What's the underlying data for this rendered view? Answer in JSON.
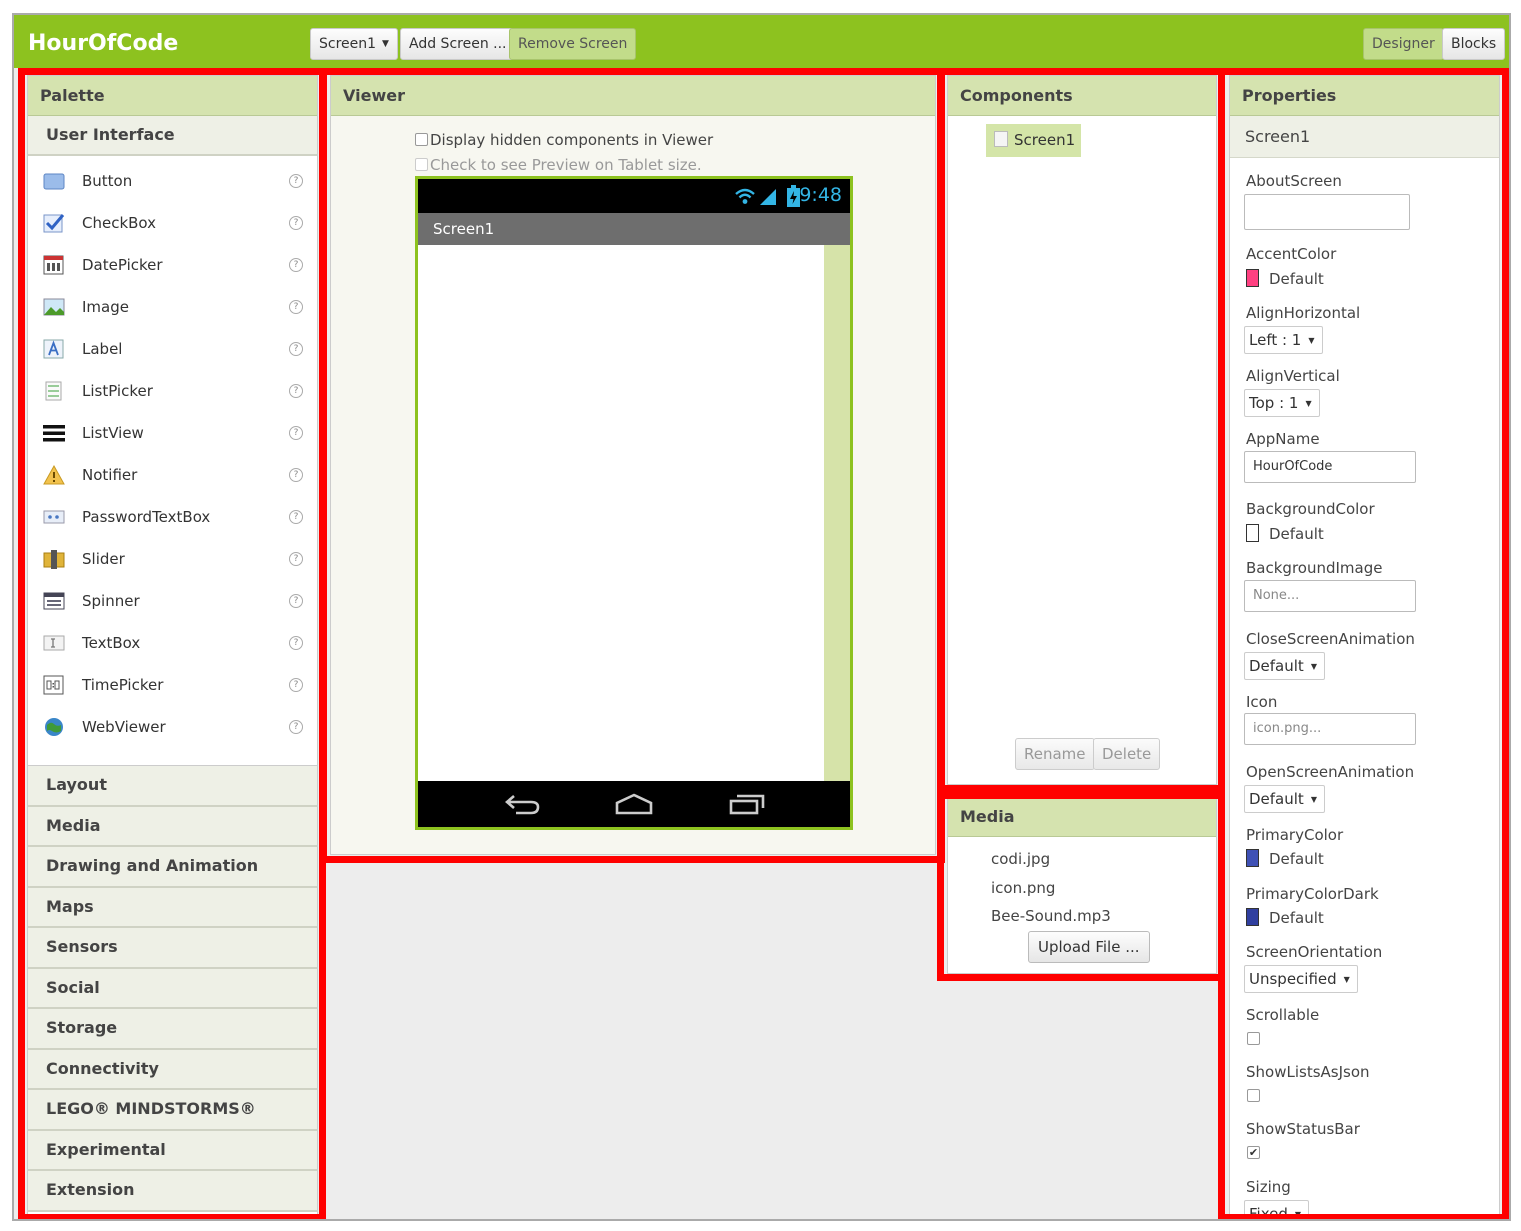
{
  "app": {
    "title": "HourOfCode"
  },
  "toolbar": {
    "screen_select": "Screen1",
    "add_screen": "Add Screen ...",
    "remove_screen": "Remove Screen",
    "designer": "Designer",
    "blocks": "Blocks"
  },
  "palette": {
    "title": "Palette",
    "open_category": "User Interface",
    "items": [
      {
        "label": "Button",
        "icon": "button-icon"
      },
      {
        "label": "CheckBox",
        "icon": "checkbox-icon"
      },
      {
        "label": "DatePicker",
        "icon": "datepicker-icon"
      },
      {
        "label": "Image",
        "icon": "image-icon"
      },
      {
        "label": "Label",
        "icon": "label-icon"
      },
      {
        "label": "ListPicker",
        "icon": "listpicker-icon"
      },
      {
        "label": "ListView",
        "icon": "listview-icon"
      },
      {
        "label": "Notifier",
        "icon": "notifier-icon"
      },
      {
        "label": "PasswordTextBox",
        "icon": "password-icon"
      },
      {
        "label": "Slider",
        "icon": "slider-icon"
      },
      {
        "label": "Spinner",
        "icon": "spinner-icon"
      },
      {
        "label": "TextBox",
        "icon": "textbox-icon"
      },
      {
        "label": "TimePicker",
        "icon": "timepicker-icon"
      },
      {
        "label": "WebViewer",
        "icon": "webviewer-icon"
      }
    ],
    "help_glyph": "?",
    "categories": [
      "Layout",
      "Media",
      "Drawing and Animation",
      "Maps",
      "Sensors",
      "Social",
      "Storage",
      "Connectivity",
      "LEGO® MINDSTORMS®",
      "Experimental",
      "Extension"
    ]
  },
  "viewer": {
    "title": "Viewer",
    "display_hidden": "Display hidden components in Viewer",
    "tablet_preview": "Check to see Preview on Tablet size.",
    "phone": {
      "time": "9:48",
      "screen_title": "Screen1"
    }
  },
  "components": {
    "title": "Components",
    "tree_root": "Screen1",
    "rename": "Rename",
    "delete": "Delete"
  },
  "media": {
    "title": "Media",
    "files": [
      "codi.jpg",
      "icon.png",
      "Bee-Sound.mp3"
    ],
    "upload": "Upload File ..."
  },
  "properties": {
    "title": "Properties",
    "component": "Screen1",
    "about_screen": {
      "label": "AboutScreen",
      "value": ""
    },
    "accent_color": {
      "label": "AccentColor",
      "value": "Default",
      "swatch": "#ff4081"
    },
    "align_horizontal": {
      "label": "AlignHorizontal",
      "value": "Left : 1"
    },
    "align_vertical": {
      "label": "AlignVertical",
      "value": "Top : 1"
    },
    "app_name": {
      "label": "AppName",
      "value": "HourOfCode"
    },
    "background_color": {
      "label": "BackgroundColor",
      "value": "Default",
      "swatch": "#ffffff"
    },
    "background_image": {
      "label": "BackgroundImage",
      "value": "None..."
    },
    "close_screen_animation": {
      "label": "CloseScreenAnimation",
      "value": "Default"
    },
    "icon": {
      "label": "Icon",
      "value": "icon.png..."
    },
    "open_screen_animation": {
      "label": "OpenScreenAnimation",
      "value": "Default"
    },
    "primary_color": {
      "label": "PrimaryColor",
      "value": "Default",
      "swatch": "#3f51b5"
    },
    "primary_color_dark": {
      "label": "PrimaryColorDark",
      "value": "Default",
      "swatch": "#303f9f"
    },
    "screen_orientation": {
      "label": "ScreenOrientation",
      "value": "Unspecified"
    },
    "scrollable": {
      "label": "Scrollable",
      "checked": false
    },
    "show_lists_as_json": {
      "label": "ShowListsAsJson",
      "checked": false
    },
    "show_status_bar": {
      "label": "ShowStatusBar",
      "checked": true
    },
    "sizing": {
      "label": "Sizing",
      "value": "Fixed"
    }
  },
  "colors": {
    "brand_green": "#8dc21f",
    "panel_header": "#d5e3af",
    "highlight_red": "#ff0000"
  }
}
